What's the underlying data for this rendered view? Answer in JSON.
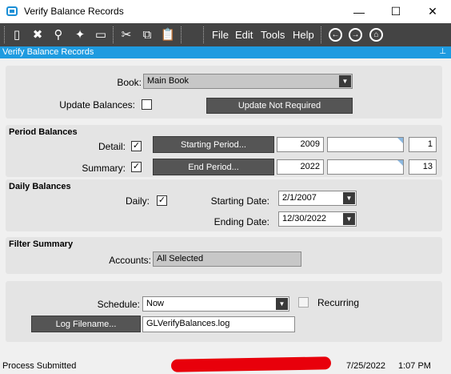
{
  "window": {
    "title": "Verify Balance Records",
    "minimize": "—",
    "maximize": "☐",
    "close": "✕"
  },
  "toolbar": {
    "menus": [
      "File",
      "Edit",
      "Tools",
      "Help"
    ]
  },
  "header": {
    "title": "Verify Balance Records",
    "pin": "📌"
  },
  "book_section": {
    "book_label": "Book:",
    "book_value": "Main Book",
    "update_balances_label": "Update Balances:",
    "update_balances_checked": false,
    "update_button": "Update Not Required"
  },
  "period_balances": {
    "title": "Period Balances",
    "detail_label": "Detail:",
    "detail_checked": true,
    "starting_period_button": "Starting Period...",
    "start_year": "2009",
    "start_desc": "",
    "start_period": "1",
    "summary_label": "Summary:",
    "summary_checked": true,
    "end_period_button": "End Period...",
    "end_year": "2022",
    "end_desc": "",
    "end_period": "13"
  },
  "daily_balances": {
    "title": "Daily Balances",
    "daily_label": "Daily:",
    "daily_checked": true,
    "starting_date_label": "Starting Date:",
    "starting_date": "2/1/2007",
    "ending_date_label": "Ending Date:",
    "ending_date": "12/30/2022"
  },
  "filter_summary": {
    "title": "Filter Summary",
    "accounts_label": "Accounts:",
    "accounts_value": "All Selected"
  },
  "schedule_section": {
    "schedule_label": "Schedule:",
    "schedule_value": "Now",
    "recurring_label": "Recurring",
    "recurring_checked": false,
    "log_button": "Log Filename...",
    "log_value": "GLVerifyBalances.log"
  },
  "status": {
    "text": "Process Submitted",
    "date": "7/25/2022",
    "time": "1:07 PM"
  },
  "colors": {
    "accent": "#1e9be0",
    "toolbar": "#444444",
    "panel": "#e4e4e4",
    "redaction": "#e8000b"
  }
}
